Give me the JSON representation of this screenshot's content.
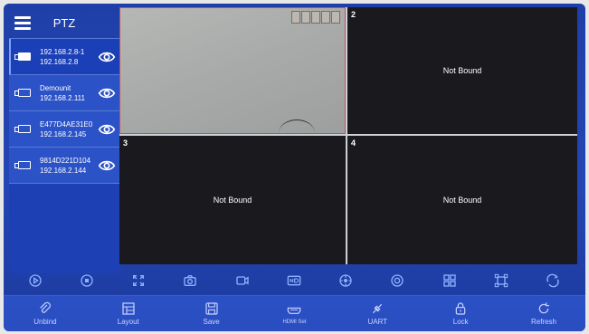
{
  "sidebar": {
    "title": "PTZ",
    "devices": [
      {
        "name": "192.168.2.8-1",
        "ip": "192.168.2.8"
      },
      {
        "name": "Demounit",
        "ip": "192.168.2.111"
      },
      {
        "name": "E477D4AE31E0",
        "ip": "192.168.2.145"
      },
      {
        "name": "9814D221D104",
        "ip": "192.168.2.144"
      }
    ]
  },
  "grid": {
    "cells": [
      {
        "number": "",
        "status": ""
      },
      {
        "number": "2",
        "status": "Not Bound"
      },
      {
        "number": "3",
        "status": "Not Bound"
      },
      {
        "number": "4",
        "status": "Not Bound"
      }
    ]
  },
  "toolbar": {
    "icons": [
      "play-icon",
      "stop-icon",
      "fullscreen-icon",
      "snapshot-icon",
      "record-icon",
      "hd-icon",
      "ptz-joystick-icon",
      "focus-icon",
      "grid-layout-icon",
      "crop-icon",
      "rotate-icon"
    ]
  },
  "bottombar": {
    "unbind": "Unbind",
    "layout": "Layout",
    "save": "Save",
    "hdmi": "HDMI Set",
    "uart": "UART",
    "lock": "Lock",
    "refresh": "Refresh"
  },
  "colors": {
    "accent": "#1f3fa8",
    "active_border": "#d34a5a",
    "icon": "#8fb0ff"
  }
}
